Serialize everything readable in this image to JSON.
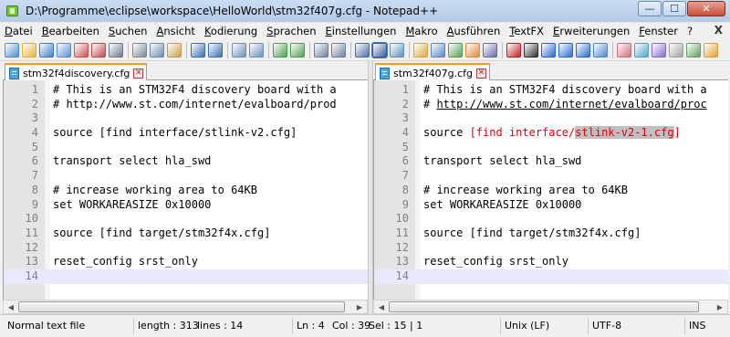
{
  "window": {
    "title": "D:\\Programme\\eclipse\\workspace\\HelloWorld\\stm32f407g.cfg - Notepad++",
    "minimize": "—",
    "maximize": "☐",
    "close": "✕"
  },
  "menu": {
    "items": [
      "Datei",
      "Bearbeiten",
      "Suchen",
      "Ansicht",
      "Kodierung",
      "Sprachen",
      "Einstellungen",
      "Makro",
      "Ausführen",
      "TextFX",
      "Erweiterungen",
      "Fenster",
      "?"
    ],
    "close": "X"
  },
  "toolbar": {
    "icons": [
      "new-file-icon",
      "open-file-icon",
      "save-icon",
      "save-all-icon",
      "close-icon",
      "close-all-icon",
      "print-icon",
      "cut-icon",
      "copy-icon",
      "paste-icon",
      "undo-icon",
      "redo-icon",
      "find-icon",
      "replace-icon",
      "zoom-in-icon",
      "zoom-out-icon",
      "sync-v-icon",
      "sync-h-icon",
      "wrap-icon",
      "all-chars-icon",
      "indent-guide-icon",
      "compare-icon",
      "doc-map-icon",
      "lang-icon",
      "function-list-icon",
      "monitor-icon",
      "record-macro-icon",
      "stop-macro-icon",
      "play-macro-icon",
      "run-macro-icon",
      "save-macro-icon",
      "spellcheck-icon",
      "plugin1-icon",
      "plugin2-icon",
      "plugin3-icon",
      "plugin4-icon",
      "plugin5-icon",
      "plugin6-icon"
    ]
  },
  "left_pane": {
    "tab": "stm32f4discovery.cfg",
    "lines": [
      {
        "n": "1",
        "text": "# This is an STM32F4 discovery board with a"
      },
      {
        "n": "2",
        "text": "# http://www.st.com/internet/evalboard/prod"
      },
      {
        "n": "3",
        "text": ""
      },
      {
        "n": "4",
        "text": "source [find interface/stlink-v2.cfg]"
      },
      {
        "n": "5",
        "text": ""
      },
      {
        "n": "6",
        "text": "transport select hla_swd"
      },
      {
        "n": "7",
        "text": ""
      },
      {
        "n": "8",
        "text": "# increase working area to 64KB"
      },
      {
        "n": "9",
        "text": "set WORKAREASIZE 0x10000"
      },
      {
        "n": "10",
        "text": ""
      },
      {
        "n": "11",
        "text": "source [find target/stm32f4x.cfg]"
      },
      {
        "n": "12",
        "text": ""
      },
      {
        "n": "13",
        "text": "reset_config srst_only"
      },
      {
        "n": "14",
        "text": ""
      }
    ]
  },
  "right_pane": {
    "tab": "stm32f407g.cfg",
    "lines": [
      {
        "n": "1",
        "text": "# This is an STM32F4 discovery board with a"
      },
      {
        "n": "2",
        "text": "# http://www.st.com/internet/evalboard/proc"
      },
      {
        "n": "3",
        "text": ""
      },
      {
        "n": "4",
        "text": "source [find interface/stlink-v2-1.cfg]"
      },
      {
        "n": "5",
        "text": ""
      },
      {
        "n": "6",
        "text": "transport select hla_swd"
      },
      {
        "n": "7",
        "text": ""
      },
      {
        "n": "8",
        "text": "# increase working area to 64KB"
      },
      {
        "n": "9",
        "text": "set WORKAREASIZE 0x10000"
      },
      {
        "n": "10",
        "text": ""
      },
      {
        "n": "11",
        "text": "source [find target/stm32f4x.cfg]"
      },
      {
        "n": "12",
        "text": ""
      },
      {
        "n": "13",
        "text": "reset_config srst_only"
      },
      {
        "n": "14",
        "text": ""
      }
    ],
    "diff_line": {
      "prefix": "source ",
      "changed_open": "[find interface/",
      "selected": "stlink-v2-1.cfg",
      "changed_close": "]"
    }
  },
  "status": {
    "file_type": "Normal text file",
    "length": "length : 313",
    "lines": "lines : 14",
    "ln": "Ln : 4",
    "col": "Col : 39",
    "sel": "Sel : 15 | 1",
    "eol": "Unix (LF)",
    "encoding": "UTF-8",
    "mode": "INS"
  },
  "colors": {
    "current_line": "#e8e8ff",
    "diff_text": "#e0000a",
    "selection": "#c0c0c0",
    "tab_accent": "#fa9a1e"
  }
}
